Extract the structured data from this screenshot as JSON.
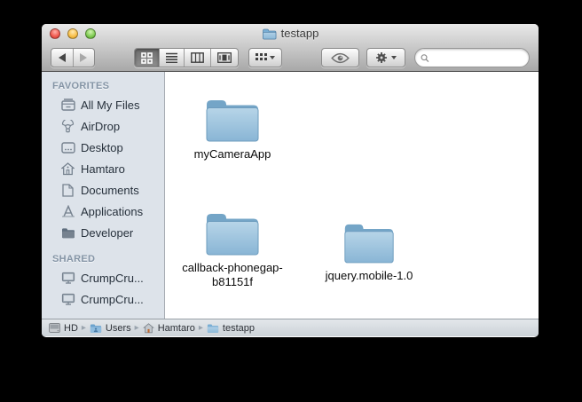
{
  "window": {
    "title": "testapp"
  },
  "toolbar": {
    "icons": {
      "back": "back-arrow-icon",
      "forward": "forward-arrow-icon",
      "view_modes": [
        "icon-view-icon",
        "list-view-icon",
        "column-view-icon",
        "coverflow-view-icon"
      ],
      "arrange": "arrange-grid-icon",
      "quick_look": "eye-icon",
      "action": "gear-icon",
      "search": "search-icon"
    },
    "search": {
      "value": "",
      "placeholder": ""
    }
  },
  "sidebar": {
    "sections": [
      {
        "title": "FAVORITES",
        "items": [
          {
            "label": "All My Files",
            "icon": "all-my-files-icon"
          },
          {
            "label": "AirDrop",
            "icon": "airdrop-icon"
          },
          {
            "label": "Desktop",
            "icon": "desktop-icon"
          },
          {
            "label": "Hamtaro",
            "icon": "home-icon"
          },
          {
            "label": "Documents",
            "icon": "documents-icon"
          },
          {
            "label": "Applications",
            "icon": "applications-icon"
          },
          {
            "label": "Developer",
            "icon": "developer-folder-icon"
          }
        ]
      },
      {
        "title": "SHARED",
        "items": [
          {
            "label": "CrumpCru...",
            "icon": "shared-computer-icon"
          },
          {
            "label": "CrumpCru...",
            "icon": "shared-computer-icon"
          }
        ]
      }
    ]
  },
  "main": {
    "folders": [
      {
        "label": "myCameraApp",
        "icon": "folder-icon"
      },
      {
        "label": "callback-phonegap-b81151f",
        "icon": "folder-icon"
      },
      {
        "label": "jquery.mobile-1.0",
        "icon": "folder-icon"
      }
    ]
  },
  "pathbar": {
    "separator": "▸",
    "items": [
      {
        "label": "HD",
        "icon": "drive-icon"
      },
      {
        "label": "Users",
        "icon": "users-folder-icon"
      },
      {
        "label": "Hamtaro",
        "icon": "home-icon"
      },
      {
        "label": "testapp",
        "icon": "folder-icon"
      }
    ]
  },
  "colors": {
    "folder_blue_light": "#b5d4e8",
    "folder_blue_dark": "#8ab6d6",
    "folder_back": "#74a5c7",
    "sidebar_bg": "#dde3ea",
    "traffic_red": "#f0584e",
    "traffic_yellow": "#f8bf47",
    "traffic_green": "#7fcb52"
  }
}
